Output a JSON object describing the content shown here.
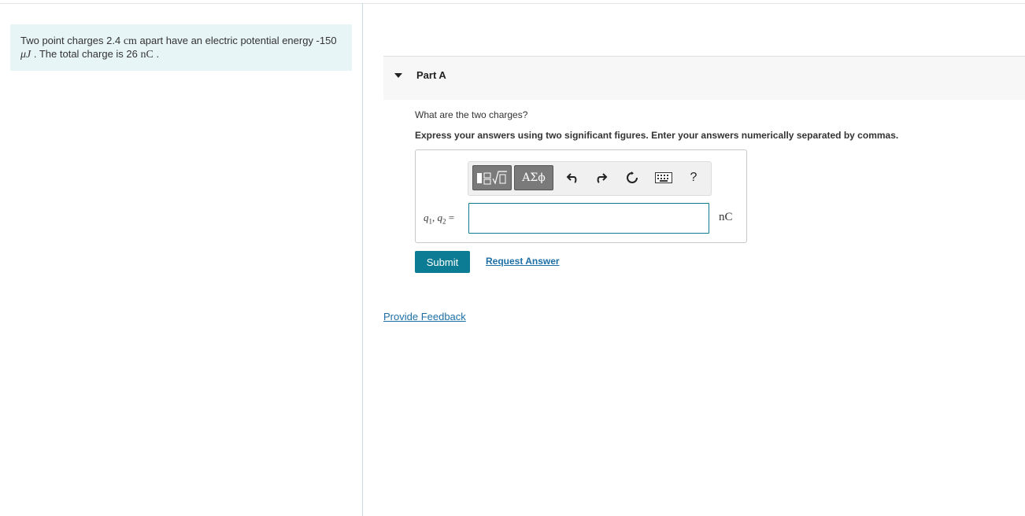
{
  "problem": {
    "text_a": "Two point charges 2.4 ",
    "dist_unit": "cm",
    "text_b": " apart have an electric potential energy -150",
    "energy_unit": "μJ",
    "text_c": " . The total charge is 26 ",
    "charge_unit": "nC",
    "text_d": " ."
  },
  "part": {
    "title": "Part A"
  },
  "question": "What are the two charges?",
  "instructions": "Express your answers using two significant figures. Enter your answers numerically separated by commas.",
  "toolbar": {
    "templates_icon": "templates-icon",
    "greek_label": "ΑΣϕ",
    "undo_icon": "undo-icon",
    "redo_icon": "redo-icon",
    "reset_icon": "reset-icon",
    "keyboard_icon": "keyboard-icon",
    "help_label": "?"
  },
  "answer": {
    "var1": "q",
    "sub1": "1",
    "sep": ", ",
    "var2": "q",
    "sub2": "2",
    "equals": " =",
    "value": "",
    "unit": "nC"
  },
  "actions": {
    "submit_label": "Submit",
    "request_label": "Request Answer",
    "feedback_label": "Provide Feedback"
  },
  "colors": {
    "problem_bg": "#e8f5f7",
    "submit_bg": "#0b7c94",
    "link": "#1d6fa5",
    "input_border": "#0e7c8f"
  }
}
